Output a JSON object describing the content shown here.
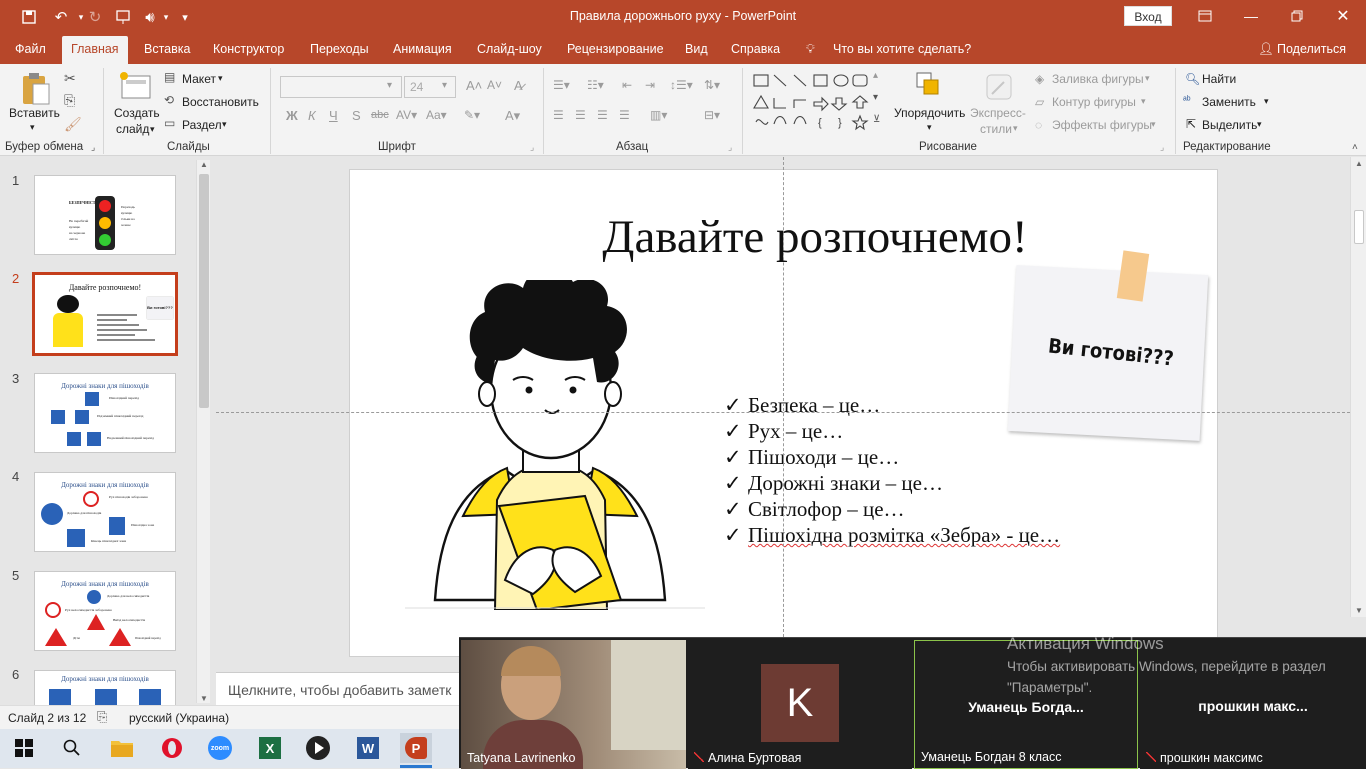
{
  "window": {
    "title": "Правила дорожнього руху  -  PowerPoint",
    "signin": "Вход"
  },
  "qat": {
    "icons": [
      "save-icon",
      "undo-icon",
      "redo-icon",
      "present-icon",
      "audio-icon",
      "customize-icon"
    ]
  },
  "menu": {
    "tabs": [
      "Файл",
      "Главная",
      "Вставка",
      "Конструктор",
      "Переходы",
      "Анимация",
      "Слайд-шоу",
      "Рецензирование",
      "Вид",
      "Справка"
    ],
    "active": "Главная",
    "tellme": "Что вы хотите сделать?",
    "share": "Поделиться"
  },
  "ribbon": {
    "clipboard": {
      "paste": "Вставить",
      "label": "Буфер обмена"
    },
    "slides": {
      "new_slide_1": "Создать",
      "new_slide_2": "слайд",
      "layout": "Макет",
      "reset": "Восстановить",
      "section": "Раздел",
      "label": "Слайды"
    },
    "font": {
      "family": "",
      "size": "24",
      "label": "Шрифт"
    },
    "paragraph": {
      "label": "Абзац"
    },
    "drawing": {
      "arrange": "Упорядочить",
      "quick_styles_1": "Экспресс-",
      "quick_styles_2": "стили",
      "fill": "Заливка фигуры",
      "outline": "Контур фигуры",
      "effects": "Эффекты фигуры",
      "label": "Рисование"
    },
    "editing": {
      "find": "Найти",
      "replace": "Заменить",
      "select": "Выделить",
      "label": "Редактирование"
    }
  },
  "thumbnails": {
    "numbers": [
      "1",
      "2",
      "3",
      "4",
      "5",
      "6"
    ],
    "t1": {
      "title": "БЕЗПЕЧНІСТЬ",
      "left": [
        "Не перебігай",
        "вулицю",
        "на червоне",
        "світло"
      ],
      "right": [
        "Переходь",
        "вулицю",
        "тільки на",
        "зелене"
      ]
    },
    "t2": {
      "title": "Давайте розпочнемо!",
      "note": "Ви готові???"
    },
    "t3": {
      "title": "Дорожні знаки для пішоходів",
      "items": [
        "Пішохідний перехід",
        "Підземний пішохідний перехід",
        "Надземний пішохідний перехід"
      ]
    },
    "t4": {
      "title": "Дорожні знаки для пішоходів",
      "items": [
        "Рух пішоходів заборонено",
        "Доріжка для пішоходів",
        "Пішохідна зона",
        "Кінець пішохідної зони"
      ]
    },
    "t5": {
      "title": "Дорожні знаки для пішоходів",
      "items": [
        "Доріжка для велосипедистів",
        "Рух велосипедистів заборонено",
        "Виїзд велосипедистів",
        "Діти",
        "Пішохідний перехід"
      ]
    },
    "t6": {
      "title": "Дорожні знаки для пішоходів"
    }
  },
  "slide": {
    "title": "Давайте розпочнемо!",
    "note": "Ви готові???",
    "bullets": [
      "Безпека – це…",
      "Рух – це…",
      "Пішоходи – це…",
      "Дорожні знаки – це…",
      "Світлофор – це…",
      "Пішохідна розмітка «Зебра» - це…"
    ],
    "check": "✓"
  },
  "notes": {
    "placeholder": "Щелкните, чтобы добавить заметк"
  },
  "status": {
    "slide": "Слайд 2 из 12",
    "language": "русский (Украина)"
  },
  "zoom": {
    "p1": "Tatyana Lavrinenko",
    "p2": "Алина Буртовая",
    "p2_initial": "K",
    "p3_center": "Уманець  Богда...",
    "p3": "Уманець Богдан 8 класс",
    "p4_center": "прошкин  макс...",
    "p4": "прошкин максимс",
    "activate_title": "Активация Windows",
    "activate_text": "Чтобы активировать Windows, перейдите в раздел \"Параметры\"."
  },
  "taskbar": {
    "apps": [
      "start-icon",
      "search-icon",
      "explorer-icon",
      "opera-icon",
      "zoom-icon",
      "excel-icon",
      "media-icon",
      "word-icon",
      "powerpoint-icon"
    ]
  },
  "colors": {
    "accent": "#b7472a",
    "selected": "#c43e1c",
    "yellow": "#ffe11a"
  }
}
